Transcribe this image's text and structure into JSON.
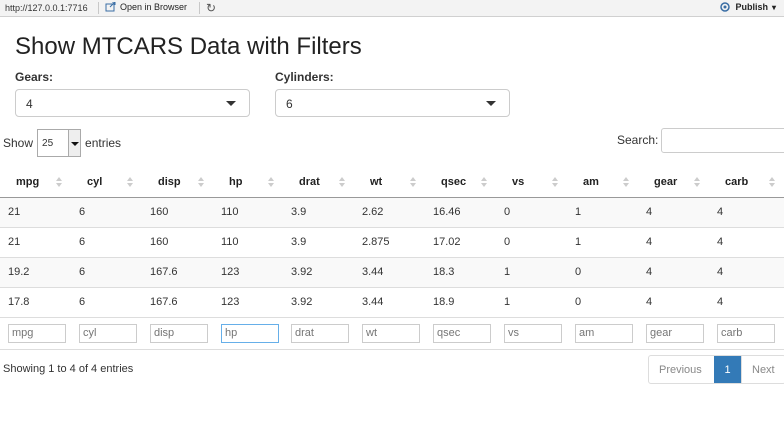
{
  "toolbar": {
    "url": "http://127.0.0.1:7716",
    "open_in_browser": "Open in Browser",
    "publish": "Publish"
  },
  "title": "Show MTCARS Data with Filters",
  "filters": {
    "gears_label": "Gears:",
    "gears_value": "4",
    "cylinders_label": "Cylinders:",
    "cylinders_value": "6"
  },
  "table_controls": {
    "show": "Show",
    "length_value": "25",
    "entries": "entries",
    "search_label": "Search:"
  },
  "table": {
    "columns": [
      "mpg",
      "cyl",
      "disp",
      "hp",
      "drat",
      "wt",
      "qsec",
      "vs",
      "am",
      "gear",
      "carb"
    ],
    "rows": [
      [
        "21",
        "6",
        "160",
        "110",
        "3.9",
        "2.62",
        "16.46",
        "0",
        "1",
        "4",
        "4"
      ],
      [
        "21",
        "6",
        "160",
        "110",
        "3.9",
        "2.875",
        "17.02",
        "0",
        "1",
        "4",
        "4"
      ],
      [
        "19.2",
        "6",
        "167.6",
        "123",
        "3.92",
        "3.44",
        "18.3",
        "1",
        "0",
        "4",
        "4"
      ],
      [
        "17.8",
        "6",
        "167.6",
        "123",
        "3.92",
        "3.44",
        "18.9",
        "1",
        "0",
        "4",
        "4"
      ]
    ],
    "filter_placeholders": [
      "mpg",
      "cyl",
      "disp",
      "hp",
      "drat",
      "wt",
      "qsec",
      "vs",
      "am",
      "gear",
      "carb"
    ]
  },
  "info": "Showing 1 to 4 of 4 entries",
  "pagination": {
    "previous": "Previous",
    "current_page": "1",
    "next": "Next"
  },
  "colors": {
    "accent": "#337ab7"
  }
}
